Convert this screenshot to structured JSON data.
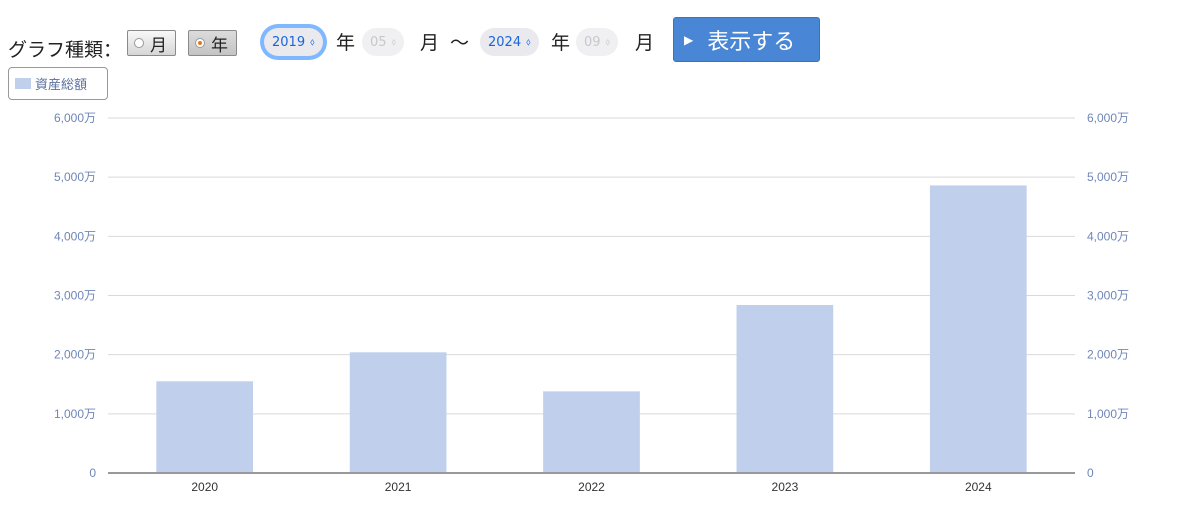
{
  "controls": {
    "graph_type_label": "グラフ種類：",
    "option_month": "月",
    "option_year": "年",
    "start_year": "2019",
    "start_year_unit": "年",
    "start_month": "05",
    "start_month_unit": "月",
    "range_separator": "〜",
    "end_year": "2024",
    "end_year_unit": "年",
    "end_month": "09",
    "end_month_unit": "月",
    "show_button": "表示する",
    "selected_option": "年"
  },
  "colors": {
    "bar": "#bfcfec",
    "axis_label": "#6f86b8",
    "button": "#4a86d6",
    "radio_selected": "#e07a1f"
  },
  "chart_data": {
    "type": "bar",
    "legend": [
      "資産総額"
    ],
    "categories": [
      "2020",
      "2021",
      "2022",
      "2023",
      "2024"
    ],
    "series": [
      {
        "name": "資産総額",
        "values": [
          1550,
          2040,
          1380,
          2840,
          4860
        ]
      }
    ],
    "ylim": [
      0,
      6000
    ],
    "yticks": [
      "0",
      "1,000万",
      "2,000万",
      "3,000万",
      "4,000万",
      "5,000万",
      "6,000万"
    ],
    "grid": true,
    "dual_y_axis": true,
    "legend_position": "top-left"
  }
}
